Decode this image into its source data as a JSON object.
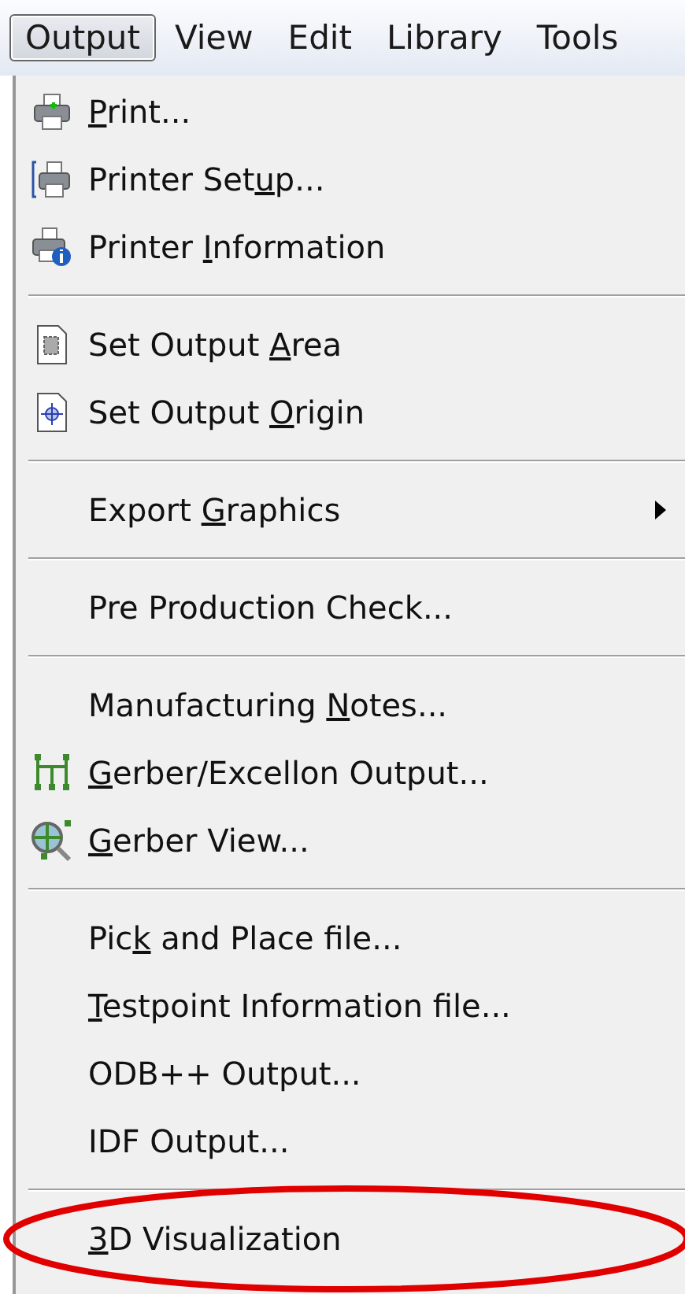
{
  "menu_bar": [
    {
      "label": "Output",
      "selected": true
    },
    {
      "label": "View",
      "selected": false
    },
    {
      "label": "Edit",
      "selected": false
    },
    {
      "label": "Library",
      "selected": false
    },
    {
      "label": "Tools",
      "selected": false
    }
  ],
  "menu": [
    {
      "kind": "item",
      "key": "P",
      "post": "rint..."
    },
    {
      "kind": "item",
      "pre": "Printer Set",
      "key": "u",
      "post": "p..."
    },
    {
      "kind": "item",
      "pre": "Printer ",
      "key": "I",
      "post": "nformation"
    },
    {
      "kind": "separator"
    },
    {
      "kind": "item",
      "pre": "Set Output ",
      "key": "A",
      "post": "rea"
    },
    {
      "kind": "item",
      "pre": "Set Output ",
      "key": "O",
      "post": "rigin"
    },
    {
      "kind": "separator"
    },
    {
      "kind": "submenu",
      "pre": "Export ",
      "key": "G",
      "post": "raphics"
    },
    {
      "kind": "separator"
    },
    {
      "kind": "item",
      "pre": "Pre Production Check..."
    },
    {
      "kind": "separator"
    },
    {
      "kind": "item",
      "pre": "Manufacturing ",
      "key": "N",
      "post": "otes..."
    },
    {
      "kind": "item",
      "key": "G",
      "post": "erber/Excellon Output..."
    },
    {
      "kind": "item",
      "key": "G",
      "post": "erber View..."
    },
    {
      "kind": "separator"
    },
    {
      "kind": "item",
      "pre": "Pic",
      "key": "k",
      "post": " and Place file..."
    },
    {
      "kind": "item",
      "key": "T",
      "post": "estpoint Information file..."
    },
    {
      "kind": "item",
      "pre": "ODB++ Output..."
    },
    {
      "kind": "item",
      "pre": "IDF Output..."
    },
    {
      "kind": "separator"
    },
    {
      "kind": "item",
      "key": "3",
      "post": "D Visualization",
      "annotation": {
        "kind": "ellipse",
        "color": "#e00000"
      }
    }
  ]
}
